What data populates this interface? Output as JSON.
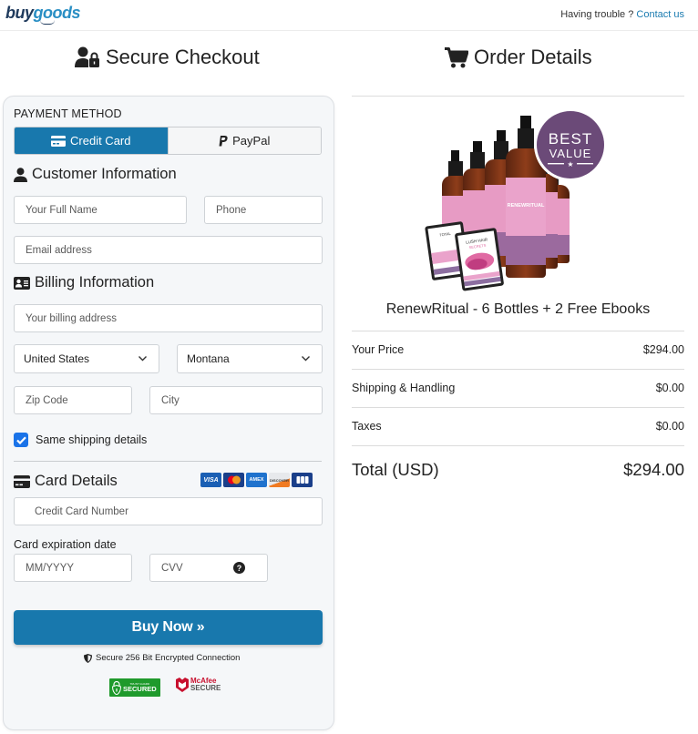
{
  "header": {
    "logo_part1": "buy",
    "logo_part2": "goods",
    "help_text": "Having trouble ?",
    "contact_link": "Contact us"
  },
  "checkout": {
    "title": "Secure Checkout",
    "payment_method_label": "PAYMENT METHOD",
    "tabs": [
      {
        "label": "Credit Card",
        "icon": "credit-card-icon",
        "active": true
      },
      {
        "label": "PayPal",
        "icon": "paypal-icon",
        "active": false
      }
    ],
    "customer_section": "Customer Information",
    "full_name_placeholder": "Your Full Name",
    "phone_placeholder": "Phone",
    "email_placeholder": "Email address",
    "billing_section": "Billing Information",
    "address_placeholder": "Your billing address",
    "country_value": "United States",
    "state_value": "Montana",
    "zip_placeholder": "Zip Code",
    "city_placeholder": "City",
    "same_shipping_label": "Same shipping details",
    "same_shipping_checked": true,
    "card_section": "Card Details",
    "card_brands": [
      "VISA",
      "Mastercard",
      "AMEX",
      "DISCOVER",
      "JCB"
    ],
    "card_number_placeholder": "Credit Card Number",
    "expiration_label": "Card expiration date",
    "expiry_placeholder": "MM/YYYY",
    "cvv_placeholder": "CVV",
    "cvv_help": "?",
    "buy_button": "Buy Now »",
    "secure_note": "Secure 256 Bit Encrypted Connection",
    "trust_badges": {
      "trustguard_top": "TRUST GUARD",
      "trustguard_main": "SECURED",
      "mcafee_line1": "McAfee",
      "mcafee_line2": "SECURE"
    }
  },
  "order": {
    "title": "Order Details",
    "badge_line1": "BEST",
    "badge_line2": "VALUE",
    "product_brand": "RENEWRITUAL",
    "ebook1": "TOTAL TRANSFORMATION",
    "ebook2": "LUSH HAIR SECRETS",
    "product_name": "RenewRitual - 6 Bottles + 2 Free Ebooks",
    "rows": [
      {
        "label": "Your Price",
        "value": "$294.00"
      },
      {
        "label": "Shipping & Handling",
        "value": "$0.00"
      },
      {
        "label": "Taxes",
        "value": "$0.00"
      }
    ],
    "total_label": "Total (USD)",
    "total_value": "$294.00"
  },
  "colors": {
    "accent": "#1878ad",
    "checkbox": "#1a73e8",
    "link": "#1a7bb0",
    "badge_purple": "#6b4a78",
    "label_pink": "#e79bc4"
  }
}
